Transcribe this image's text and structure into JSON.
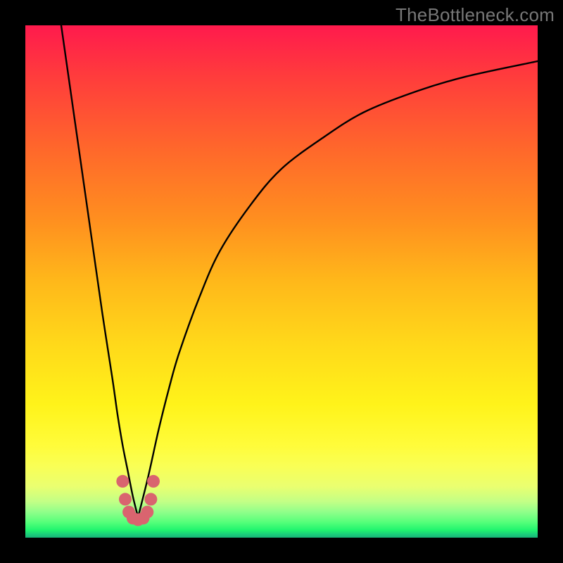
{
  "watermark": "TheBottleneck.com",
  "colors": {
    "frame": "#000000",
    "curve": "#000000",
    "marker": "#d9646f"
  },
  "chart_data": {
    "type": "line",
    "title": "",
    "xlabel": "",
    "ylabel": "",
    "xlim": [
      0,
      100
    ],
    "ylim": [
      0,
      100
    ],
    "x_optimum": 22,
    "notch_half_width": 3,
    "notch_depth": 7,
    "series": [
      {
        "name": "left-branch",
        "x": [
          7,
          9,
          11,
          13,
          15,
          17,
          18,
          19,
          20,
          21,
          22
        ],
        "y": [
          100,
          86,
          72,
          58,
          44,
          31,
          24,
          18,
          13,
          8,
          4
        ]
      },
      {
        "name": "right-branch",
        "x": [
          22,
          24,
          26,
          28,
          30,
          34,
          38,
          44,
          50,
          58,
          66,
          76,
          86,
          100
        ],
        "y": [
          4,
          12,
          21,
          29,
          36,
          47,
          56,
          65,
          72,
          78,
          83,
          87,
          90,
          93
        ]
      },
      {
        "name": "notch-markers",
        "x": [
          19.0,
          19.5,
          20.2,
          21.0,
          22.0,
          23.0,
          23.8,
          24.5,
          25.0
        ],
        "y": [
          11.0,
          7.5,
          5.0,
          3.8,
          3.5,
          3.8,
          5.0,
          7.5,
          11.0
        ]
      }
    ]
  }
}
